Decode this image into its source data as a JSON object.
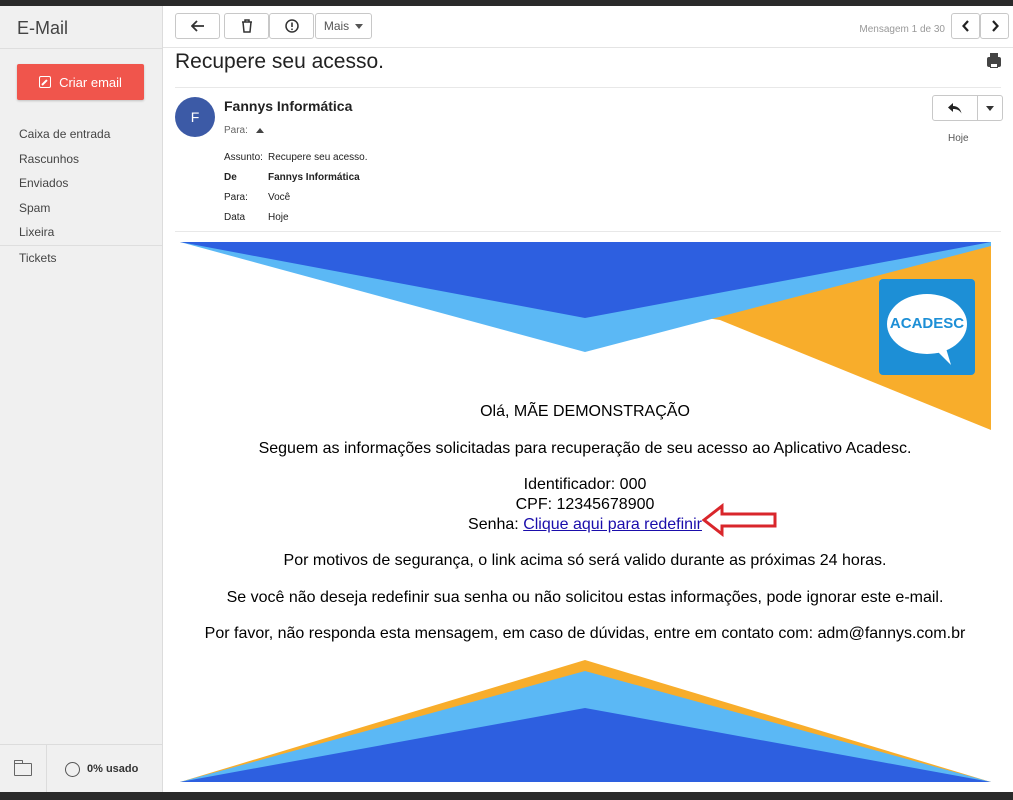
{
  "app": {
    "title": "E-Mail"
  },
  "sidebar": {
    "compose_label": "Criar email",
    "folders": [
      "Caixa de entrada",
      "Rascunhos",
      "Enviados",
      "Spam",
      "Lixeira",
      "Tickets"
    ],
    "usage": "0% usado"
  },
  "toolbar": {
    "more_label": "Mais",
    "message_counter": "Mensagem 1 de 30"
  },
  "message": {
    "subject": "Recupere seu acesso.",
    "avatar_initial": "F",
    "sender": "Fannys Informática",
    "to_label": "Para:",
    "date_short": "Hoje",
    "meta": [
      {
        "key": "Assunto:",
        "value": "Recupere seu acesso."
      },
      {
        "key": "De",
        "value": "Fannys Informática"
      },
      {
        "key": "Para:",
        "value": "Você"
      },
      {
        "key": "Data",
        "value": "Hoje"
      }
    ]
  },
  "body": {
    "logo_text": "ACADESC",
    "greeting": "Olá, MÃE DEMONSTRAÇÃO",
    "intro": "Seguem as informações solicitadas para recuperação de seu acesso ao Aplicativo Acadesc.",
    "identifier": "Identificador: 000",
    "cpf": "CPF: 12345678900",
    "password_label": "Senha: ",
    "reset_link": "Clique aqui para redefinir",
    "security_note": "Por motivos de segurança, o link acima só será valido durante as próximas 24 horas.",
    "ignore_note": "Se você não deseja redefinir sua senha ou não solicitou estas informações, pode ignorar este e-mail.",
    "contact_note": "Por favor, não responda esta mensagem, em caso de dúvidas, entre em contato com: adm@fannys.com.br"
  },
  "colors": {
    "compose": "#f0554c",
    "avatar": "#3c5aa6",
    "banner_dark_blue": "#2d5fe0",
    "banner_light_blue": "#5bb8f5",
    "banner_orange": "#f8ad2b",
    "logo_blue": "#1d8fd6",
    "annotation_red": "#d9262b"
  }
}
